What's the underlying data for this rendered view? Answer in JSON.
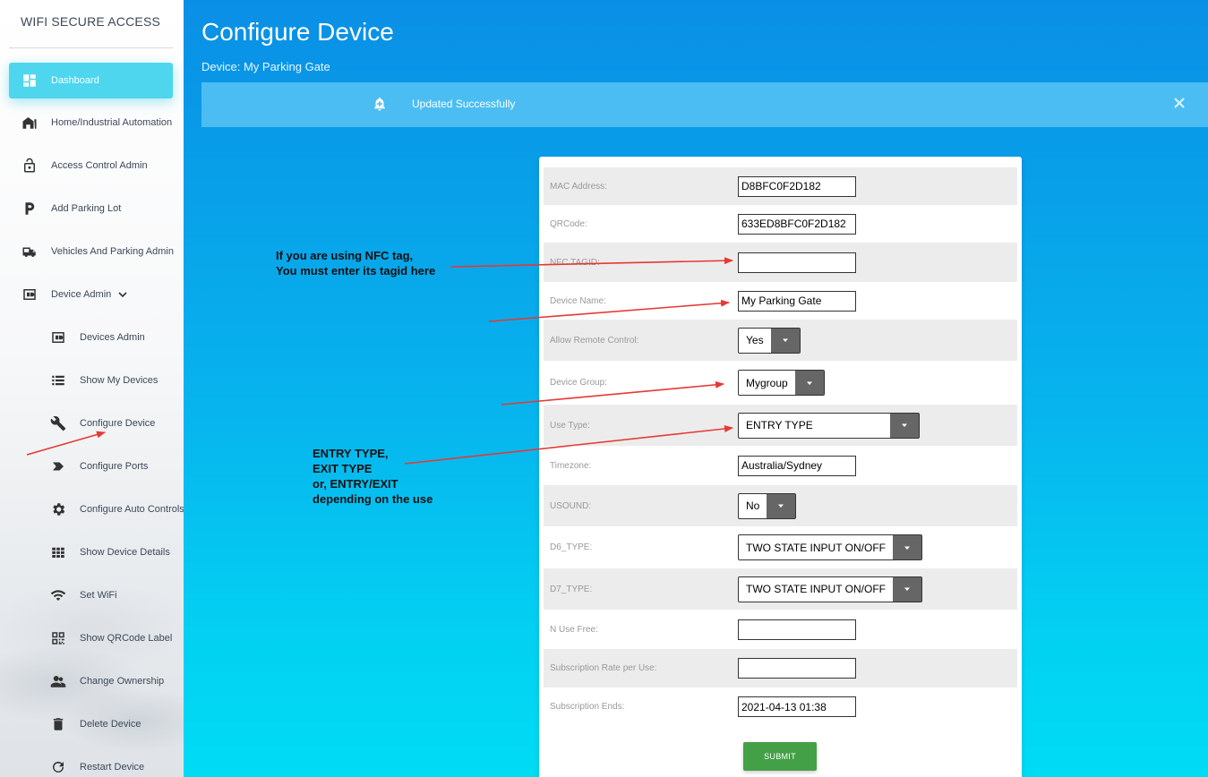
{
  "app": {
    "title": "WIFI SECURE ACCESS"
  },
  "sidebar": {
    "items": [
      {
        "label": "Dashboard",
        "icon": "dashboard-icon"
      },
      {
        "label": "Home/Industrial Automation",
        "icon": "home-icon"
      },
      {
        "label": "Access Control Admin",
        "icon": "lock-icon"
      },
      {
        "label": "Add Parking Lot",
        "icon": "parking-icon"
      },
      {
        "label": "Vehicles And Parking Admin",
        "icon": "vehicles-icon"
      },
      {
        "label": "Device Admin",
        "icon": "device-admin-icon"
      }
    ],
    "sub_items": [
      {
        "label": "Devices Admin",
        "icon": "device-icon"
      },
      {
        "label": "Show My Devices",
        "icon": "list-icon"
      },
      {
        "label": "Configure Device",
        "icon": "wrench-icon"
      },
      {
        "label": "Configure Ports",
        "icon": "label-icon"
      },
      {
        "label": "Configure Auto Controls",
        "icon": "gear-icon"
      },
      {
        "label": "Show Device Details",
        "icon": "grid-icon"
      },
      {
        "label": "Set WiFi",
        "icon": "wifi-icon"
      },
      {
        "label": "Show QRCode Label",
        "icon": "qrcode-icon"
      },
      {
        "label": "Change Ownership",
        "icon": "people-icon"
      },
      {
        "label": "Delete Device",
        "icon": "trash-icon"
      },
      {
        "label": "Restart Device",
        "icon": "refresh-icon"
      }
    ]
  },
  "header": {
    "title": "Configure Device",
    "subtitle": "Device: My Parking Gate"
  },
  "alert": {
    "message": "Updated Successfully"
  },
  "form": {
    "mac_label": "MAC Address:",
    "mac_value": "D8BFC0F2D182",
    "qr_label": "QRCode:",
    "qr_value": "633ED8BFC0F2D182",
    "nfc_label": "NFC TAGID:",
    "nfc_value": "",
    "name_label": "Device Name:",
    "name_value": "My Parking Gate",
    "remote_label": "Allow Remote Control:",
    "remote_value": "Yes",
    "group_label": "Device Group:",
    "group_value": "Mygroup",
    "usetype_label": "Use Type:",
    "usetype_value": "ENTRY TYPE",
    "tz_label": "Timezone:",
    "tz_value": "Australia/Sydney",
    "usound_label": "USOUND:",
    "usound_value": "No",
    "d6_label": "D6_TYPE:",
    "d6_value": "TWO STATE INPUT ON/OFF",
    "d7_label": "D7_TYPE:",
    "d7_value": "TWO STATE INPUT ON/OFF",
    "nfree_label": "N Use Free:",
    "nfree_value": "",
    "rate_label": "Subscription Rate per Use:",
    "rate_value": "",
    "ends_label": "Subscription Ends:",
    "ends_value": "2021-04-13 01:38",
    "submit_label": "SUBMIT"
  },
  "annotations": {
    "nfc_line1": "If you are using NFC tag,",
    "nfc_line2": "You must enter its tagid here",
    "use_line1": "ENTRY TYPE,",
    "use_line2": "EXIT TYPE",
    "use_line3": "or, ENTRY/EXIT",
    "use_line4": "depending on the use"
  },
  "colors": {
    "accent": "#4dd6ee",
    "main_gradient_top": "#0a8fe6",
    "main_gradient_bottom": "#00dcf4",
    "alert_bg": "#4bbdf3",
    "submit": "#43a047",
    "arrow": "#e53935"
  }
}
